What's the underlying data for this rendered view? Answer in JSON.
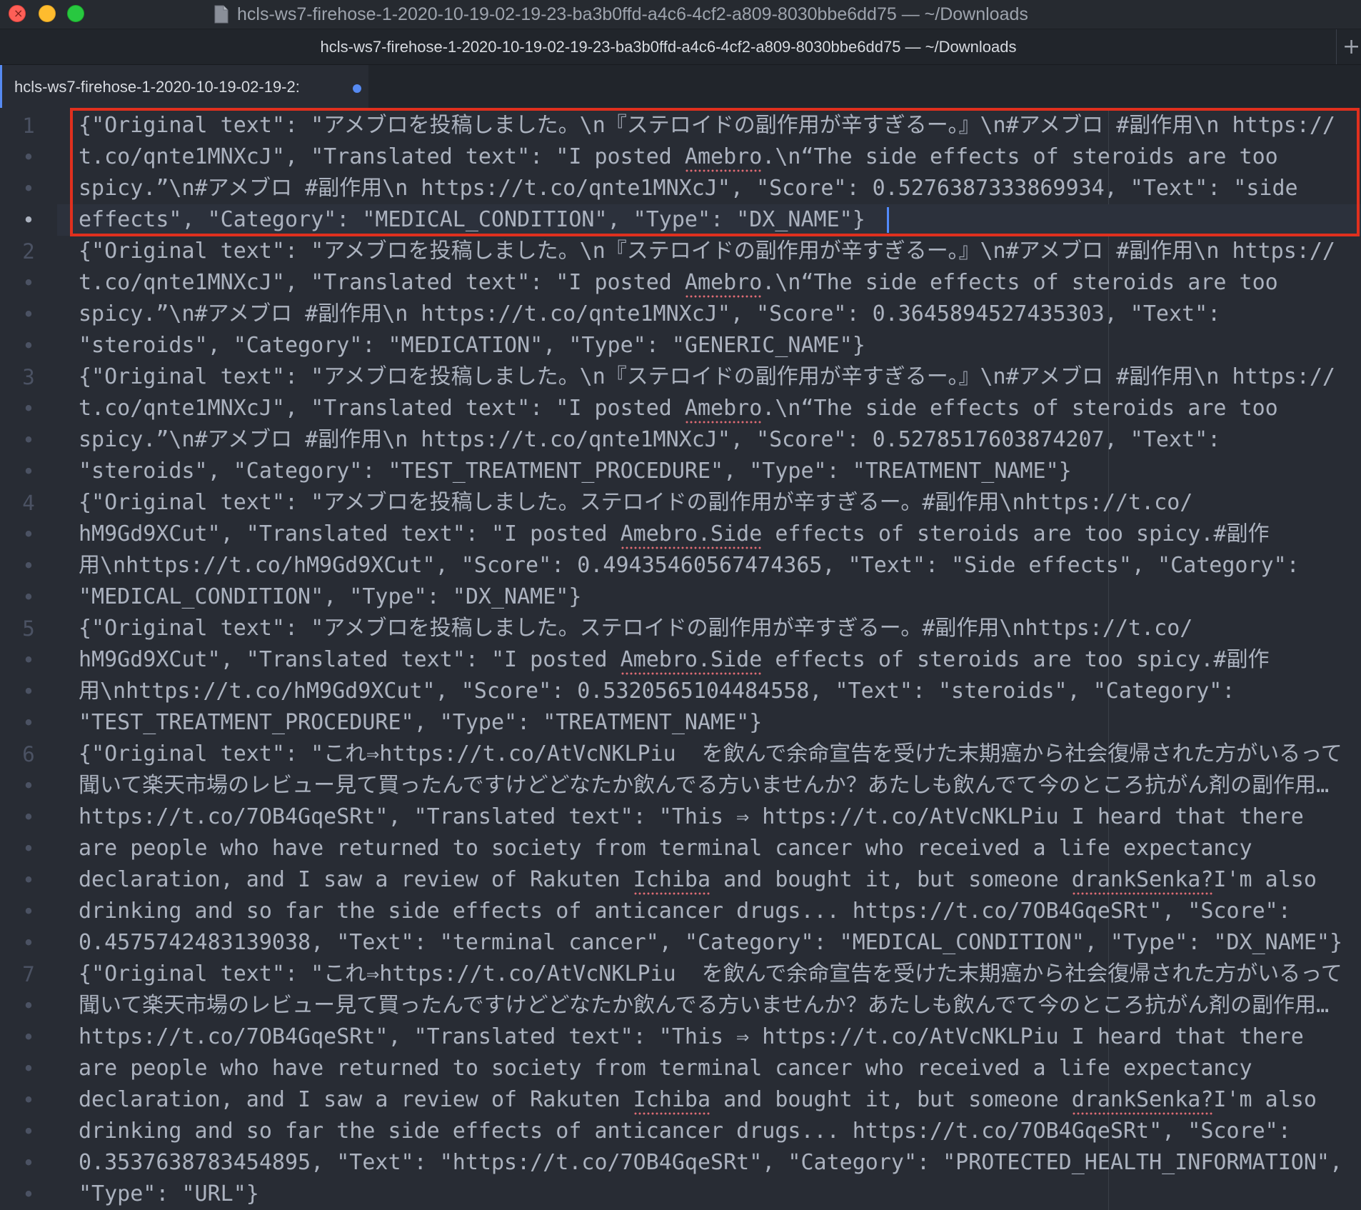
{
  "window": {
    "title": "hcls-ws7-firehose-1-2020-10-19-02-19-23-ba3b0ffd-a4c6-4cf2-a809-8030bbe6dd75 — ~/Downloads",
    "header_title": "hcls-ws7-firehose-1-2020-10-19-02-19-23-ba3b0ffd-a4c6-4cf2-a809-8030bbe6dd75 — ~/Downloads",
    "close_glyph": "×",
    "new_tab_glyph": "+"
  },
  "tab": {
    "label": "hcls-ws7-firehose-1-2020-10-19-02-19-2:",
    "modified": true
  },
  "editor": {
    "line_numbers": [
      "1",
      "2",
      "3",
      "4",
      "5",
      "6",
      "7"
    ],
    "wrap_marker": "•",
    "rows": [
      "{\"Original text\": \"アメブロを投稿しました。\\n『ステロイドの副作用が辛すぎるー。』\\n#アメブロ #副作用\\n https://",
      "t.co/qnte1MNXcJ\", \"Translated text\": \"I posted Amebro.\\n“The side effects of steroids are too",
      "spicy.”\\n#アメブロ #副作用\\n https://t.co/qnte1MNXcJ\", \"Score\": 0.5276387333869934, \"Text\": \"side",
      "effects\", \"Category\": \"MEDICAL_CONDITION\", \"Type\": \"DX_NAME\"}",
      "{\"Original text\": \"アメブロを投稿しました。\\n『ステロイドの副作用が辛すぎるー。』\\n#アメブロ #副作用\\n https://",
      "t.co/qnte1MNXcJ\", \"Translated text\": \"I posted Amebro.\\n“The side effects of steroids are too",
      "spicy.”\\n#アメブロ #副作用\\n https://t.co/qnte1MNXcJ\", \"Score\": 0.3645894527435303, \"Text\":",
      "\"steroids\", \"Category\": \"MEDICATION\", \"Type\": \"GENERIC_NAME\"}",
      "{\"Original text\": \"アメブロを投稿しました。\\n『ステロイドの副作用が辛すぎるー。』\\n#アメブロ #副作用\\n https://",
      "t.co/qnte1MNXcJ\", \"Translated text\": \"I posted Amebro.\\n“The side effects of steroids are too",
      "spicy.”\\n#アメブロ #副作用\\n https://t.co/qnte1MNXcJ\", \"Score\": 0.5278517603874207, \"Text\":",
      "\"steroids\", \"Category\": \"TEST_TREATMENT_PROCEDURE\", \"Type\": \"TREATMENT_NAME\"}",
      "{\"Original text\": \"アメブロを投稿しました。ステロイドの副作用が辛すぎるー。#副作用\\nhttps://t.co/",
      "hM9Gd9XCut\", \"Translated text\": \"I posted Amebro.Side effects of steroids are too spicy.#副作",
      "用\\nhttps://t.co/hM9Gd9XCut\", \"Score\": 0.49435460567474365, \"Text\": \"Side effects\", \"Category\":",
      "\"MEDICAL_CONDITION\", \"Type\": \"DX_NAME\"}",
      "{\"Original text\": \"アメブロを投稿しました。ステロイドの副作用が辛すぎるー。#副作用\\nhttps://t.co/",
      "hM9Gd9XCut\", \"Translated text\": \"I posted Amebro.Side effects of steroids are too spicy.#副作",
      "用\\nhttps://t.co/hM9Gd9XCut\", \"Score\": 0.5320565104484558, \"Text\": \"steroids\", \"Category\":",
      "\"TEST_TREATMENT_PROCEDURE\", \"Type\": \"TREATMENT_NAME\"}",
      "{\"Original text\": \"これ⇒https://t.co/AtVcNKLPiu  を飲んで余命宣告を受けた末期癌から社会復帰された方がいるって",
      "聞いて楽天市場のレビュー見て買ったんですけどどなたか飲んでる方いませんか？あたしも飲んでて今のところ抗がん剤の副作用…",
      "https://t.co/7OB4GqeSRt\", \"Translated text\": \"This ⇒ https://t.co/AtVcNKLPiu I heard that there",
      "are people who have returned to society from terminal cancer who received a life expectancy",
      "declaration, and I saw a review of Rakuten Ichiba and bought it, but someone drankSenka?I'm also",
      "drinking and so far the side effects of anticancer drugs... https://t.co/7OB4GqeSRt\", \"Score\":",
      "0.4575742483139038, \"Text\": \"terminal cancer\", \"Category\": \"MEDICAL_CONDITION\", \"Type\": \"DX_NAME\"}",
      "{\"Original text\": \"これ⇒https://t.co/AtVcNKLPiu  を飲んで余命宣告を受けた末期癌から社会復帰された方がいるって",
      "聞いて楽天市場のレビュー見て買ったんですけどどなたか飲んでる方いませんか？あたしも飲んでて今のところ抗がん剤の副作用…",
      "https://t.co/7OB4GqeSRt\", \"Translated text\": \"This ⇒ https://t.co/AtVcNKLPiu I heard that there",
      "are people who have returned to society from terminal cancer who received a life expectancy",
      "declaration, and I saw a review of Rakuten Ichiba and bought it, but someone drankSenka?I'm also",
      "drinking and so far the side effects of anticancer drugs... https://t.co/7OB4GqeSRt\", \"Score\":",
      "0.3537638783454895, \"Text\": \"https://t.co/7OB4GqeSRt\", \"Category\": \"PROTECTED_HEALTH_INFORMATION\",",
      "\"Type\": \"URL\"}"
    ],
    "row_line_numbers": [
      1,
      0,
      0,
      0,
      2,
      0,
      0,
      0,
      3,
      0,
      0,
      0,
      4,
      0,
      0,
      0,
      5,
      0,
      0,
      0,
      6,
      0,
      0,
      0,
      0,
      0,
      0,
      7,
      0,
      0,
      0,
      0,
      0,
      0,
      0
    ],
    "highlighted_rows": [
      0,
      1,
      2,
      3
    ],
    "active_row": 3
  },
  "colors": {
    "accent": "#568af2",
    "highlight_border": "#e0301e",
    "text": "#abb2bf",
    "background": "#282c34"
  }
}
